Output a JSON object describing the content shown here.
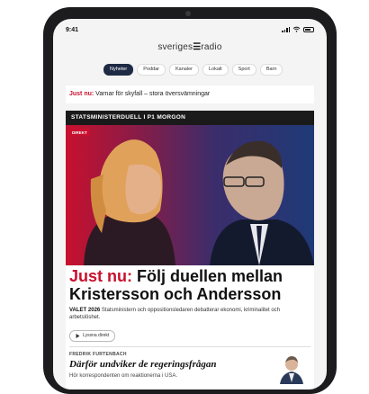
{
  "status": {
    "time": "9:41"
  },
  "site": {
    "logo_pre": "sveriges",
    "logo_mark": "☰",
    "logo_post": "radio"
  },
  "tabs": [
    "Nyheter",
    "Poddar",
    "Kanaler",
    "Lokalt",
    "Sport",
    "Barn"
  ],
  "alert": {
    "prefix": "Just nu:",
    "text": " Varnar för skyfall – stora översvämningar"
  },
  "feature": {
    "kicker": "STATSMINISTERDUELL I P1 MORGON",
    "badge": "DIREKT",
    "headline_prefix": "Just nu:",
    "headline_text": " Följ duellen mellan Kristersson och Andersson",
    "sub_prefix": "VALET 2026",
    "sub_text": " Statsministern och oppositionsledaren debatterar ekonomi, kriminalitet och arbetslöshet.",
    "listen_label": "Lyssna direkt"
  },
  "story": {
    "author": "FREDRIK FURTENBACH",
    "title": "Därför undviker de regeringsfrågan",
    "sub": "Hör korrespondenten om reaktionerna i USA."
  },
  "colors": {
    "accent": "#c8102e",
    "nav_active": "#1f2a44"
  }
}
